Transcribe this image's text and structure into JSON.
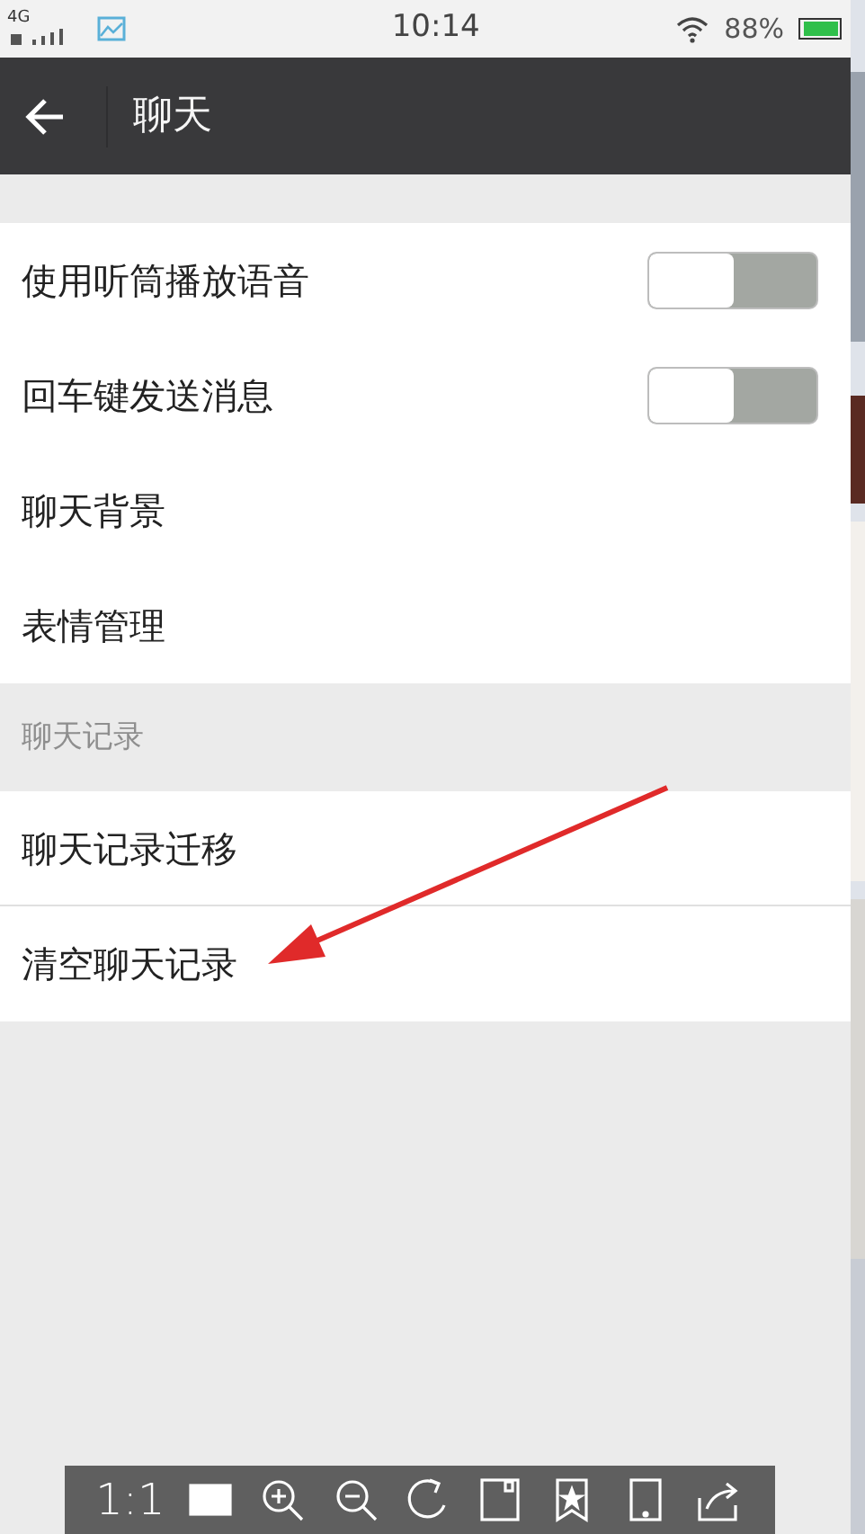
{
  "status_bar": {
    "network": "4G",
    "time": "10:14",
    "battery": "88%"
  },
  "header": {
    "title": "聊天"
  },
  "groups": [
    {
      "items": [
        {
          "kind": "toggle",
          "label": "使用听筒播放语音",
          "on": false
        },
        {
          "kind": "toggle",
          "label": "回车键发送消息",
          "on": false
        },
        {
          "kind": "link",
          "label": "聊天背景"
        },
        {
          "kind": "link",
          "label": "表情管理"
        }
      ]
    },
    {
      "title": "聊天记录",
      "items": [
        {
          "kind": "link",
          "label": "聊天记录迁移"
        },
        {
          "kind": "link",
          "label": "清空聊天记录"
        }
      ]
    }
  ],
  "viewer_toolbar": {
    "actual_size": "1:1"
  }
}
